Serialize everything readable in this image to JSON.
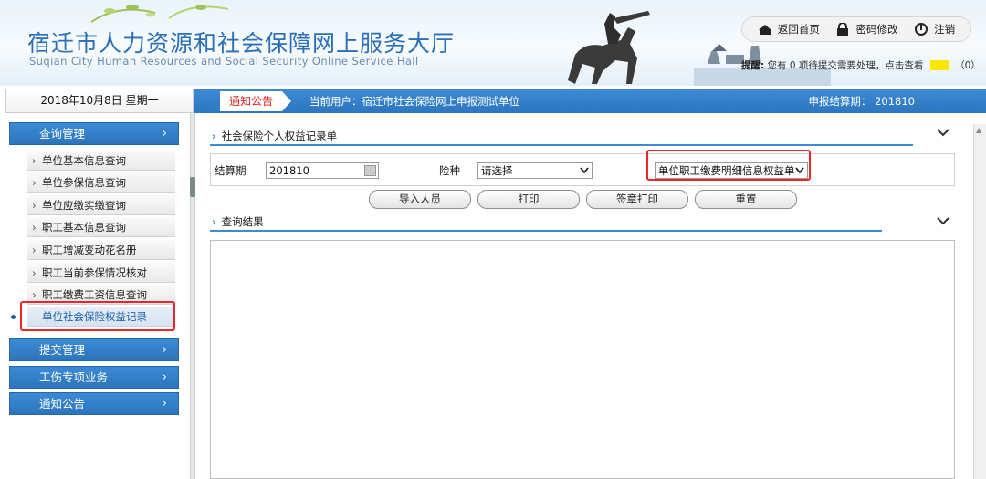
{
  "header": {
    "title_cn": "宿迁市人力资源和社会保障网上服务大厅",
    "title_en": "Suqian City Human Resources and Social Security Online Service Hall",
    "nav": {
      "home": "返回首页",
      "password": "密码修改",
      "logout": "注销"
    },
    "reminder": {
      "label": "提醒:",
      "text": "您有 0 项待提交需要处理，点击查看",
      "count": "（0）"
    }
  },
  "datebar": {
    "date": "2018年10月8日 星期一"
  },
  "noticebar": {
    "tag": "通知公告",
    "current_user": "当前用户：宿迁市社会保险网上申报测试单位",
    "period": "申报结算期： 201810"
  },
  "sidebar": {
    "groups": [
      {
        "label": "查询管理",
        "chevron": "›"
      },
      {
        "label": "提交管理",
        "chevron": "›"
      },
      {
        "label": "工伤专项业务",
        "chevron": "›"
      },
      {
        "label": "通知公告",
        "chevron": "›"
      }
    ],
    "items": [
      {
        "label": "单位基本信息查询"
      },
      {
        "label": "单位参保信息查询"
      },
      {
        "label": "单位应缴实缴查询"
      },
      {
        "label": "职工基本信息查询"
      },
      {
        "label": "职工增减变动花名册"
      },
      {
        "label": "职工当前参保情况核对"
      },
      {
        "label": "职工缴费工资信息查询"
      },
      {
        "label": "单位社会保险权益记录"
      }
    ]
  },
  "main": {
    "section1_title": "社会保险个人权益记录单",
    "form": {
      "period_label": "结算期",
      "period_value": "201810",
      "insurance_label": "险种",
      "insurance_value": "请选择",
      "report_type_value": "单位职工缴费明细信息权益单"
    },
    "buttons": {
      "import": "导入人员",
      "print": "打印",
      "seal_print": "签章打印",
      "reset": "重置"
    },
    "section2_title": "查询结果"
  },
  "colors": {
    "brand_blue": "#2d76c0",
    "highlight_red": "#e8262b"
  },
  "icons": {
    "home": "home-icon",
    "lock": "lock-icon",
    "power": "power-icon",
    "chevron": "chevron-down-icon"
  }
}
